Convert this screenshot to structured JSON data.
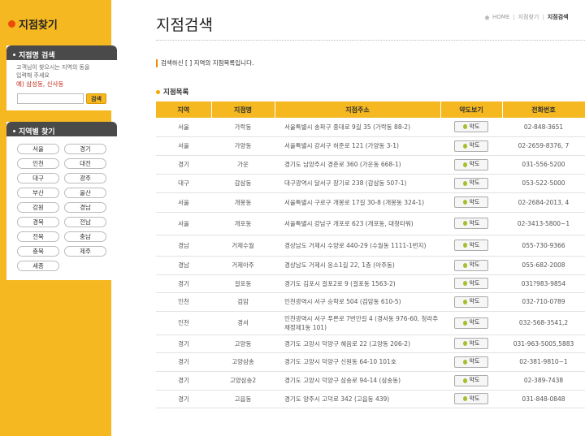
{
  "sidebar": {
    "title": "지점찾기",
    "search": {
      "heading": "지점명 검색",
      "desc1": "고객님이 찾으시는 지역의 동을",
      "desc2": "입력해 주세요",
      "example": "예) 삼성동, 신사동",
      "placeholder": "",
      "button": "검색"
    },
    "regions_heading": "지역별 찾기",
    "regions": [
      "서울",
      "경기",
      "인천",
      "대전",
      "대구",
      "광주",
      "부산",
      "울산",
      "강원",
      "경남",
      "경북",
      "전남",
      "전북",
      "충남",
      "충북",
      "제주",
      "세종"
    ]
  },
  "page": {
    "title": "지점검색",
    "breadcrumb": [
      "HOME",
      "지점찾기",
      "지점검색"
    ],
    "result_msg": "검색하신 [ ] 지역의 지점목록입니다.",
    "list_title": "지점목록"
  },
  "table": {
    "columns": [
      "지역",
      "지점명",
      "지점주소",
      "약도보기",
      "전화번호"
    ],
    "map_label": "약도",
    "rows": [
      {
        "region": "서울",
        "name": "가락동",
        "addr": "서울특별시 송파구 중대로 9길 35 (가락동 88-2)",
        "tel": "02-848-3651"
      },
      {
        "region": "서울",
        "name": "가양동",
        "addr": "서울특별시 강서구 허준로 121 (가양동 3-1)",
        "tel": "02-2659-8376, 7"
      },
      {
        "region": "경기",
        "name": "가운",
        "addr": "경기도 남양주시 경춘로 360 (가운동 668-1)",
        "tel": "031-556-5200"
      },
      {
        "region": "대구",
        "name": "감삼동",
        "addr": "대구광역시 달서구 장기로 238 (감삼동 507-1)",
        "tel": "053-522-5000"
      },
      {
        "region": "서울",
        "name": "개봉동",
        "addr": "서울특별시 구로구 개봉로 17길 30-8 (개봉동 324-1)",
        "tel": "02-2684-2013, 4"
      },
      {
        "region": "서울",
        "name": "개포동",
        "addr": "서울특별시 강남구 개포로 623 (개포동, 대청타워)",
        "tel": "02-3413-5800~1"
      },
      {
        "region": "경남",
        "name": "거제수월",
        "addr": "경상남도 거제시 수양로 440-29 (수월동 1111-1번지)",
        "tel": "055-730-9366"
      },
      {
        "region": "경남",
        "name": "거제아주",
        "addr": "경상남도 거제시 옹소1길 22, 1층 (아주동)",
        "tel": "055-682-2008"
      },
      {
        "region": "경기",
        "name": "걸포동",
        "addr": "경기도 김포시 걸포2로 9 (걸포동 1563-2)",
        "tel": "031?983-9854"
      },
      {
        "region": "인천",
        "name": "검암",
        "addr": "인천광역시 서구 승학로 504 (검암동 610-5)",
        "tel": "032-710-0789"
      },
      {
        "region": "인천",
        "name": "경서",
        "addr": "인천광역시 서구 푸른로 7번안길 4 (경서동 976-60, 청라주채정제1동 101)",
        "tel": "032-568-3541,2"
      },
      {
        "region": "경기",
        "name": "고양동",
        "addr": "경기도 고양시 덕양구 혜음로 22 (고양동 206-2)",
        "tel": "031-963-5005,5883"
      },
      {
        "region": "경기",
        "name": "고양삼송",
        "addr": "경기도 고양시 덕양구 신원동 64-10 101호",
        "tel": "02-381-9810~1"
      },
      {
        "region": "경기",
        "name": "고양삼송2",
        "addr": "경기도 고양시 덕양구 삼송로 94-14 (삼송동)",
        "tel": "02-389-7438"
      },
      {
        "region": "경기",
        "name": "고읍동",
        "addr": "경기도 양주시 고덕로 342 (고읍동 439)",
        "tel": "031-848-0848"
      }
    ]
  }
}
